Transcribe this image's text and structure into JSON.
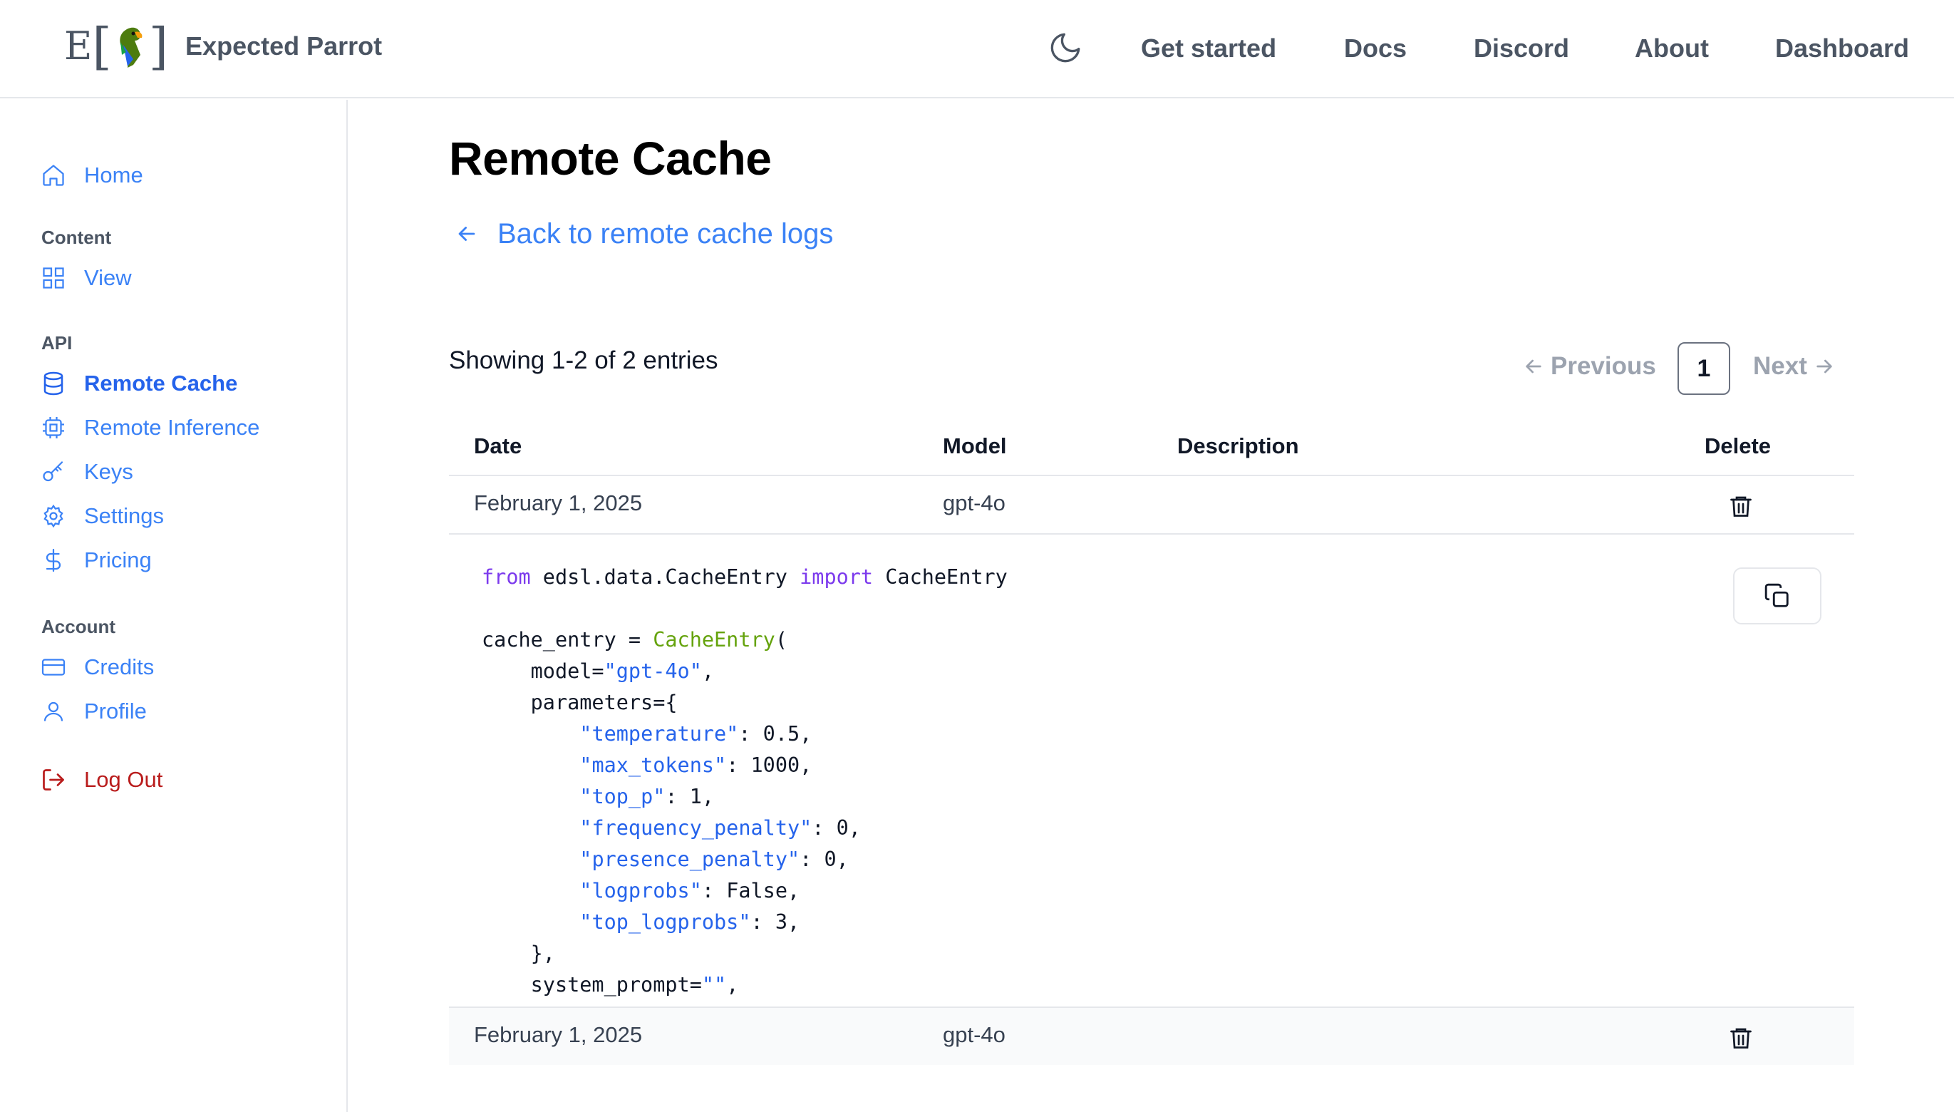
{
  "header": {
    "brand_name": "Expected Parrot",
    "logo_letter": "E",
    "nav": [
      "Get started",
      "Docs",
      "Discord",
      "About",
      "Dashboard"
    ]
  },
  "sidebar": {
    "home": "Home",
    "sections": [
      {
        "heading": "Content",
        "items": [
          "View"
        ]
      },
      {
        "heading": "API",
        "items": [
          "Remote Cache",
          "Remote Inference",
          "Keys",
          "Settings",
          "Pricing"
        ]
      },
      {
        "heading": "Account",
        "items": [
          "Credits",
          "Profile"
        ]
      }
    ],
    "logout": "Log Out",
    "active_item": "Remote Cache"
  },
  "main": {
    "title": "Remote Cache",
    "back_link": "Back to remote cache logs",
    "entries_summary": "Showing 1-2 of 2 entries",
    "pagination": {
      "previous": "Previous",
      "current_page": "1",
      "next": "Next"
    },
    "table": {
      "columns": [
        "Date",
        "Model",
        "Description",
        "Delete"
      ],
      "rows": [
        {
          "date": "February 1, 2025",
          "model": "gpt-4o",
          "description": ""
        },
        {
          "date": "February 1, 2025",
          "model": "gpt-4o",
          "description": ""
        }
      ]
    },
    "code": {
      "import_from": "from",
      "module": " edsl.data.CacheEntry ",
      "import_kw": "import",
      "import_name": " CacheEntry",
      "assign": "cache_entry = ",
      "class_name": "CacheEntry",
      "open_paren": "(",
      "model_key": "    model=",
      "model_val": "\"gpt-4o\"",
      "comma": ",",
      "parameters_open": "    parameters={",
      "params": [
        {
          "key": "\"temperature\"",
          "value": ": 0.5,"
        },
        {
          "key": "\"max_tokens\"",
          "value": ": 1000,"
        },
        {
          "key": "\"top_p\"",
          "value": ": 1,"
        },
        {
          "key": "\"frequency_penalty\"",
          "value": ": 0,"
        },
        {
          "key": "\"presence_penalty\"",
          "value": ": 0,"
        },
        {
          "key": "\"logprobs\"",
          "value": ": False,"
        },
        {
          "key": "\"top_logprobs\"",
          "value": ": 3,"
        }
      ],
      "parameters_close": "    },",
      "system_prompt_key": "    system_prompt=",
      "system_prompt_val": "\"\"",
      "system_prompt_end": ","
    }
  },
  "colors": {
    "accent": "#3b82f6",
    "active": "#2563eb",
    "logout": "#b91c1c",
    "code_keyword": "#7c3aed",
    "code_class": "#65a30d",
    "code_string": "#2563eb"
  },
  "icons": {
    "theme_toggle": "moon-icon",
    "home": "home-icon",
    "view": "grid-icon",
    "remote_cache": "database-icon",
    "remote_inference": "cpu-icon",
    "keys": "key-icon",
    "settings": "gear-icon",
    "pricing": "dollar-icon",
    "credits": "credit-card-icon",
    "profile": "user-icon",
    "logout": "logout-icon",
    "back": "arrow-left-icon",
    "copy": "copy-icon",
    "delete": "trash-icon"
  }
}
